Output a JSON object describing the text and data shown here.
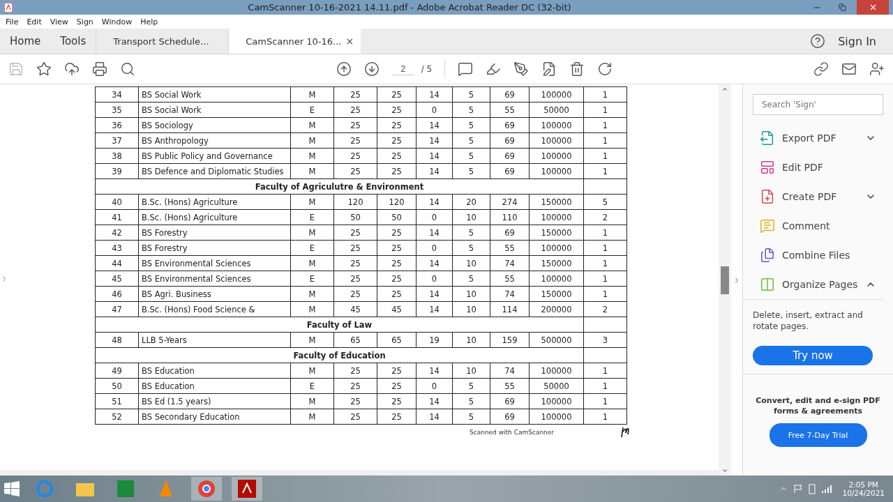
{
  "window": {
    "title": "CamScanner 10-16-2021 14.11.pdf - Adobe Acrobat Reader DC (32-bit)"
  },
  "menu": [
    "File",
    "Edit",
    "View",
    "Sign",
    "Window",
    "Help"
  ],
  "tabs": [
    {
      "label": "Home",
      "kind": "nav",
      "selected": false
    },
    {
      "label": "Tools",
      "kind": "nav",
      "selected": false
    },
    {
      "label": "Transport Schedule...",
      "kind": "doc",
      "selected": false
    },
    {
      "label": "CamScanner 10-16...",
      "kind": "doc",
      "selected": true,
      "close": "×"
    }
  ],
  "sign_in": "Sign In",
  "page_nav": {
    "current": "2",
    "total": "/ 5"
  },
  "table": {
    "rows": [
      {
        "kind": "row",
        "cells": [
          "34",
          "BS Social Work",
          "M",
          "25",
          "25",
          "14",
          "5",
          "69",
          "100000",
          "1"
        ]
      },
      {
        "kind": "row",
        "cells": [
          "35",
          "BS Social Work",
          "E",
          "25",
          "25",
          "0",
          "5",
          "55",
          "50000",
          "1"
        ]
      },
      {
        "kind": "row",
        "cells": [
          "36",
          "BS Sociology",
          "M",
          "25",
          "25",
          "14",
          "5",
          "69",
          "100000",
          "1"
        ]
      },
      {
        "kind": "row",
        "cells": [
          "37",
          "BS Anthropology",
          "M",
          "25",
          "25",
          "14",
          "5",
          "69",
          "100000",
          "1"
        ]
      },
      {
        "kind": "row",
        "cells": [
          "38",
          "BS Public Policy and Governance",
          "M",
          "25",
          "25",
          "14",
          "5",
          "69",
          "100000",
          "1"
        ]
      },
      {
        "kind": "row",
        "cells": [
          "39",
          "BS Defence and Diplomatic Studies",
          "M",
          "25",
          "25",
          "14",
          "5",
          "69",
          "100000",
          "1"
        ]
      },
      {
        "kind": "section",
        "title": "Faculty of Agriculutre & Environment"
      },
      {
        "kind": "row",
        "cells": [
          "40",
          "B.Sc. (Hons) Agriculture",
          "M",
          "120",
          "120",
          "14",
          "20",
          "274",
          "150000",
          "5"
        ]
      },
      {
        "kind": "row",
        "cells": [
          "41",
          "B.Sc. (Hons) Agriculture",
          "E",
          "50",
          "50",
          "0",
          "10",
          "110",
          "100000",
          "2"
        ]
      },
      {
        "kind": "row",
        "cells": [
          "42",
          "BS Forestry",
          "M",
          "25",
          "25",
          "14",
          "5",
          "69",
          "150000",
          "1"
        ]
      },
      {
        "kind": "row",
        "cells": [
          "43",
          "BS Forestry",
          "E",
          "25",
          "25",
          "0",
          "5",
          "55",
          "100000",
          "1"
        ]
      },
      {
        "kind": "row",
        "cells": [
          "44",
          "BS Environmental Sciences",
          "M",
          "25",
          "25",
          "14",
          "10",
          "74",
          "150000",
          "1"
        ]
      },
      {
        "kind": "row",
        "cells": [
          "45",
          "BS Environmental Sciences",
          "E",
          "25",
          "25",
          "0",
          "5",
          "55",
          "100000",
          "1"
        ]
      },
      {
        "kind": "row",
        "cells": [
          "46",
          "BS Agri. Business",
          "M",
          "25",
          "25",
          "14",
          "10",
          "74",
          "150000",
          "1"
        ]
      },
      {
        "kind": "row",
        "cells": [
          "47",
          "B.Sc. (Hons) Food Science &",
          "M",
          "45",
          "45",
          "14",
          "10",
          "114",
          "200000",
          "2"
        ]
      },
      {
        "kind": "section",
        "title": "Faculty of Law"
      },
      {
        "kind": "row",
        "cells": [
          "48",
          "LLB 5-Years",
          "M",
          "65",
          "65",
          "19",
          "10",
          "159",
          "500000",
          "3"
        ]
      },
      {
        "kind": "section",
        "title": "Faculty of Education"
      },
      {
        "kind": "row",
        "cells": [
          "49",
          "BS Education",
          "M",
          "25",
          "25",
          "14",
          "10",
          "74",
          "100000",
          "1"
        ]
      },
      {
        "kind": "row",
        "cells": [
          "50",
          "BS Education",
          "E",
          "25",
          "25",
          "0",
          "5",
          "55",
          "50000",
          "1"
        ]
      },
      {
        "kind": "row",
        "cells": [
          "51",
          "BS Ed (1.5 years)",
          "M",
          "25",
          "25",
          "14",
          "5",
          "69",
          "100000",
          "1"
        ]
      },
      {
        "kind": "row",
        "cells": [
          "52",
          "BS Secondary Education",
          "M",
          "25",
          "25",
          "14",
          "5",
          "69",
          "100000",
          "1"
        ]
      }
    ]
  },
  "page_footer": "Scanned with CamScanner",
  "sidebar": {
    "search": {
      "placeholder": "Search 'Sign'"
    },
    "items": [
      {
        "label": "Export PDF",
        "kind": "export",
        "expanded": false
      },
      {
        "label": "Edit PDF",
        "kind": "edit"
      },
      {
        "label": "Create PDF",
        "kind": "create",
        "expanded": false
      },
      {
        "label": "Comment",
        "kind": "comment"
      },
      {
        "label": "Combine Files",
        "kind": "combine"
      },
      {
        "label": "Organize Pages",
        "kind": "organize",
        "expanded": true
      }
    ],
    "description": "Delete, insert, extract and rotate pages.",
    "try_button": "Try now",
    "promo": "Convert, edit and e-sign PDF forms & agreements",
    "trial_button": "Free 7-Day Trial"
  },
  "taskbar": {
    "time": "2:05 PM",
    "date": "10/24/2021"
  }
}
